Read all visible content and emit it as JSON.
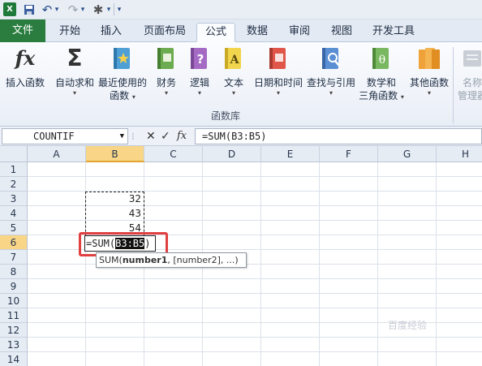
{
  "qat": {
    "app_icon": "X",
    "save": "save-icon",
    "undo": "↶",
    "redo": "↷",
    "tool": "✱",
    "customize": "▾"
  },
  "tabs": [
    {
      "label": "文件"
    },
    {
      "label": "开始"
    },
    {
      "label": "插入"
    },
    {
      "label": "页面布局"
    },
    {
      "label": "公式"
    },
    {
      "label": "数据"
    },
    {
      "label": "审阅"
    },
    {
      "label": "视图"
    },
    {
      "label": "开发工具"
    }
  ],
  "ribbon": {
    "insert_function": {
      "icon": "fx",
      "label": "插入函数"
    },
    "autosum": {
      "icon": "Σ",
      "label1": "自动求和",
      "dd": "▾"
    },
    "recent": {
      "label1": "最近使用的",
      "label2": "函数",
      "dd": "▾"
    },
    "financial": {
      "label1": "财务",
      "dd": "▾"
    },
    "logical": {
      "icon": "?",
      "label1": "逻辑",
      "dd": "▾"
    },
    "text": {
      "icon": "A",
      "label1": "文本",
      "dd": "▾"
    },
    "datetime": {
      "label1": "日期和时间",
      "dd": "▾"
    },
    "lookup": {
      "label1": "查找与引用",
      "dd": "▾"
    },
    "math": {
      "icon": "θ",
      "label1": "数学和",
      "label2": "三角函数",
      "dd": "▾"
    },
    "more": {
      "label1": "其他函数",
      "dd": "▾"
    },
    "name_mgr": {
      "label1": "名称",
      "label2": "管理器"
    },
    "group_label": "函数库"
  },
  "formula_bar": {
    "name_box": "COUNTIF",
    "cancel": "✕",
    "enter": "✓",
    "fx": "fx",
    "formula": "=SUM(B3:B5)"
  },
  "sheet": {
    "columns": [
      "A",
      "B",
      "C",
      "D",
      "E",
      "F",
      "G",
      "H"
    ],
    "rows": [
      "1",
      "2",
      "3",
      "4",
      "5",
      "6",
      "7",
      "8",
      "9",
      "10",
      "11",
      "12",
      "13",
      "14"
    ],
    "values": {
      "B3": "32",
      "B4": "43",
      "B5": "54"
    },
    "edit_prefix": "=SUM(",
    "edit_ref": "B3:B5",
    "edit_suffix": ")",
    "tooltip_func": "SUM(",
    "tooltip_arg1": "number1",
    "tooltip_rest": ", [number2], ...)"
  },
  "watermark": "百度经验",
  "colors": {
    "accent": "#e0403f",
    "file_tab": "#2a7d3f",
    "selected_header": "#f8d587"
  }
}
